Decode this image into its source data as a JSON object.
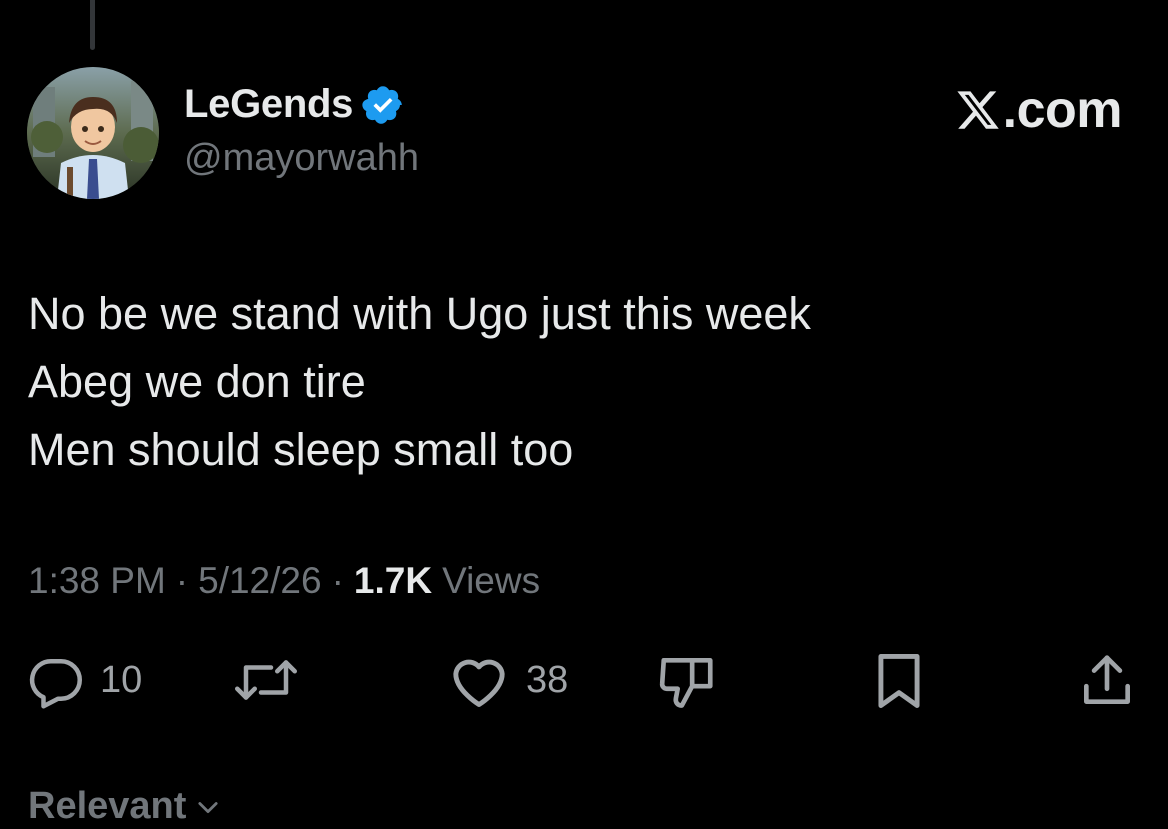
{
  "author": {
    "display_name": "LeGends",
    "handle": "@mayorwahh",
    "verified_icon": "verified-badge-icon",
    "avatar": "cartoon-boy-avatar"
  },
  "brand": {
    "label": ".com",
    "logo_icon": "x-logo-icon"
  },
  "tweet": {
    "lines": [
      "No be we stand with Ugo just this week",
      "Abeg we don tire",
      "Men should sleep small too"
    ]
  },
  "meta": {
    "time": "1:38 PM",
    "separator": "·",
    "date": "5/12/26",
    "views_count": "1.7K",
    "views_label": "Views"
  },
  "actions": {
    "reply_count": "10",
    "like_count": "38"
  },
  "sort": {
    "label": "Relevant",
    "icon": "chevron-down-icon"
  },
  "colors": {
    "background": "#000000",
    "text_primary": "#e7e9ea",
    "text_secondary": "#71767b",
    "verified": "#1d9bf0"
  }
}
